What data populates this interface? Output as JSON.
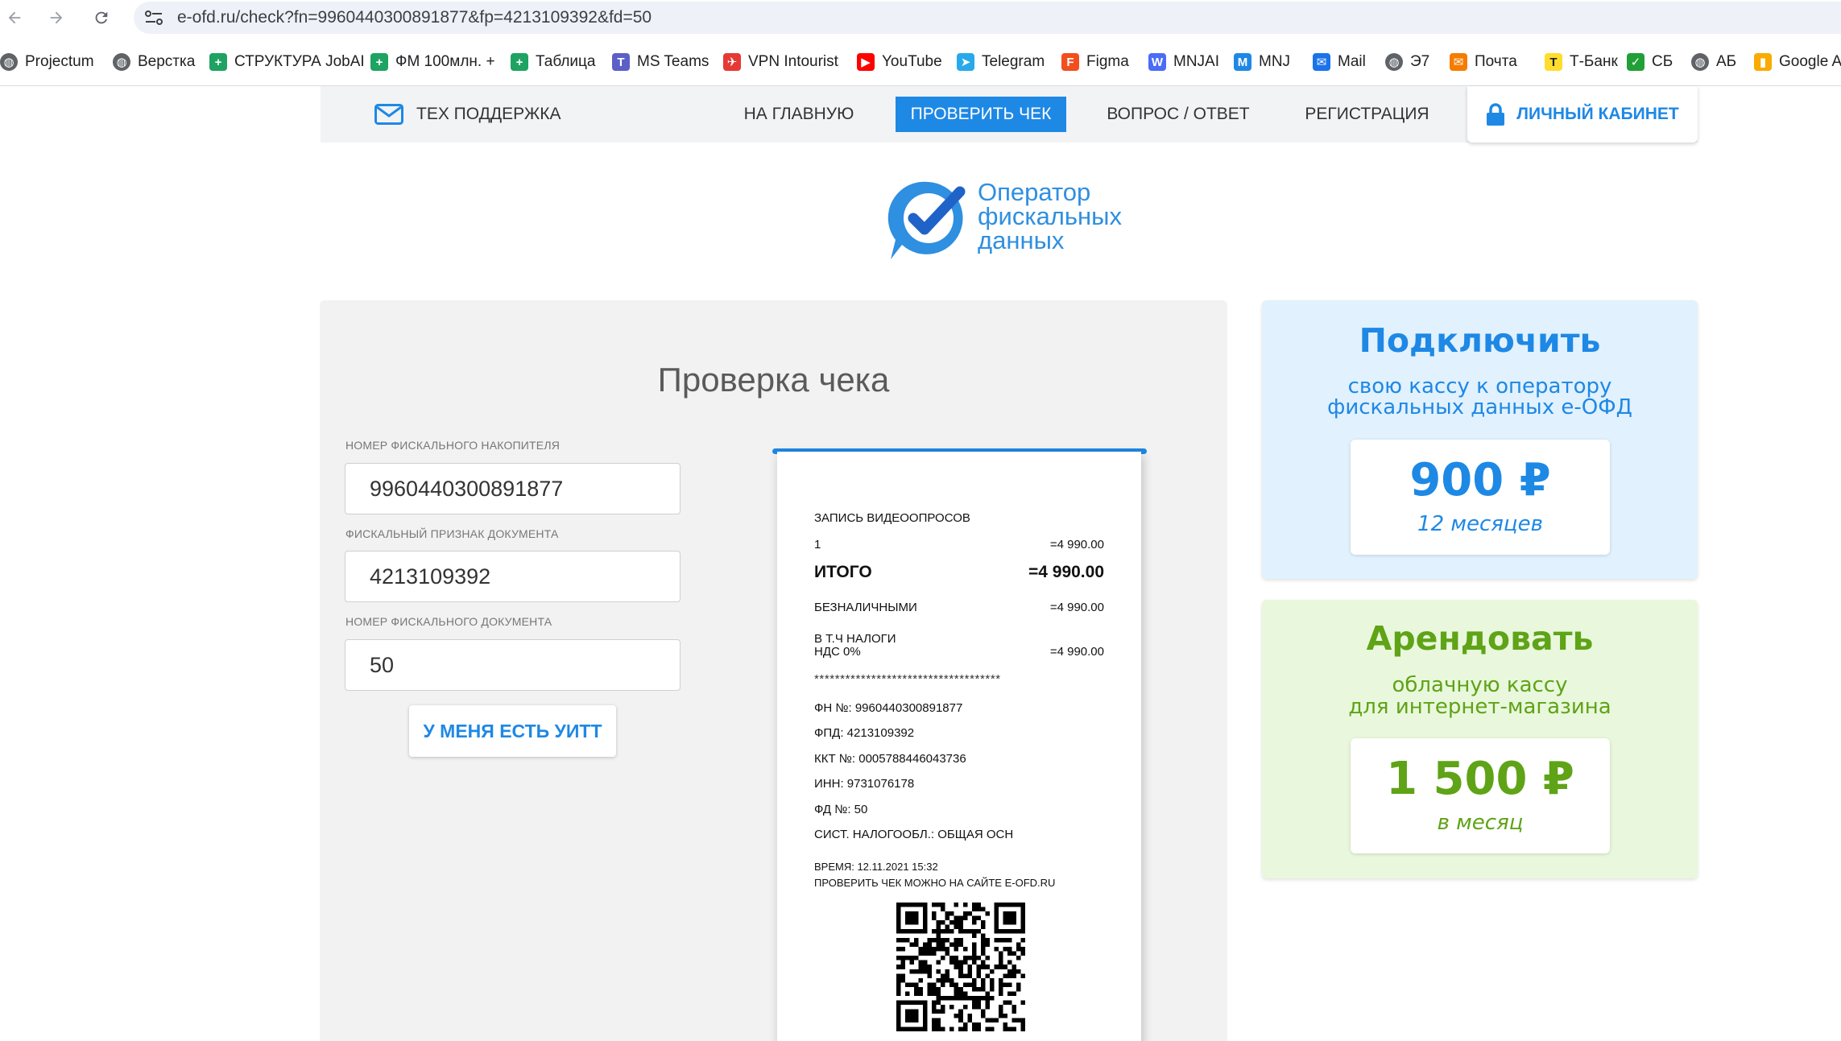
{
  "browser": {
    "url": "e-ofd.ru/check?fn=9960440300891877&fp=4213109392&fd=50",
    "bookmarks": [
      {
        "label": "Projectum",
        "icon": "globe-icon",
        "color": "#5f6368"
      },
      {
        "label": "Верстка",
        "icon": "globe-icon",
        "color": "#5f6368"
      },
      {
        "label": "СТРУКТУРА JobAI",
        "icon": "sheets-icon",
        "color": "#1ea362"
      },
      {
        "label": "ФМ 100млн. +",
        "icon": "sheets-icon",
        "color": "#1ea362"
      },
      {
        "label": "Таблица",
        "icon": "sheets-icon",
        "color": "#1ea362"
      },
      {
        "label": "MS Teams",
        "icon": "teams-icon",
        "color": "#5b5fc7"
      },
      {
        "label": "VPN Intourist",
        "icon": "plane-icon",
        "color": "#e53935"
      },
      {
        "label": "YouTube",
        "icon": "youtube-icon",
        "color": "#ff0000"
      },
      {
        "label": "Telegram",
        "icon": "telegram-icon",
        "color": "#29a9eb"
      },
      {
        "label": "Figma",
        "icon": "figma-icon",
        "color": "#f24e1e"
      },
      {
        "label": "MNJAI",
        "icon": "mnjai-icon",
        "color": "#4a6cf7"
      },
      {
        "label": "MNJ",
        "icon": "mnj-icon",
        "color": "#1e88e5"
      },
      {
        "label": "Mail",
        "icon": "mail-icon",
        "color": "#1a73e8"
      },
      {
        "label": "Э7",
        "icon": "globe-icon",
        "color": "#5f6368"
      },
      {
        "label": "Почта",
        "icon": "envelope-icon",
        "color": "#f57c00"
      },
      {
        "label": "Т-Банк",
        "icon": "tbank-icon",
        "color": "#ffdd2d"
      },
      {
        "label": "СБ",
        "icon": "sber-icon",
        "color": "#21a038"
      },
      {
        "label": "АБ",
        "icon": "globe-icon",
        "color": "#5f6368"
      },
      {
        "label": "Google A",
        "icon": "analytics-icon",
        "color": "#f9ab00"
      }
    ]
  },
  "nav": {
    "support": "ТЕХ ПОДДЕРЖКА",
    "links": [
      "НА ГЛАВНУЮ",
      "ПРОВЕРИТЬ ЧЕК",
      "ВОПРОС / ОТВЕТ",
      "РЕГИСТРАЦИЯ"
    ],
    "active_link": "ПРОВЕРИТЬ ЧЕК",
    "cabinet": "ЛИЧНЫЙ КАБИНЕТ"
  },
  "logo": {
    "line1": "Оператор",
    "line2": "фискальных",
    "line3": "данных"
  },
  "check_form": {
    "title": "Проверка чека",
    "fn_label": "НОМЕР ФИСКАЛЬНОГО НАКОПИТЕЛЯ",
    "fn_value": "9960440300891877",
    "fp_label": "ФИСКАЛЬНЫЙ ПРИЗНАК ДОКУМЕНТА",
    "fp_value": "4213109392",
    "fd_label": "НОМЕР ФИСКАЛЬНОГО ДОКУМЕНТА",
    "fd_value": "50",
    "uitt_button": "У МЕНЯ ЕСТЬ УИТТ"
  },
  "receipt": {
    "item_name": "ЗАПИСЬ ВИДЕООПРОСОВ",
    "item_qty": "1",
    "item_sum": "=4 990.00",
    "total_label": "ИТОГО",
    "total_value": "=4 990.00",
    "cashless_label": "БЕЗНАЛИЧНЫМИ",
    "cashless_value": "=4 990.00",
    "tax_label_1": "В Т.Ч НАЛОГИ",
    "tax_label_2": "НДС 0%",
    "tax_value": "=4 990.00",
    "stars": "************************************",
    "fn": "ФН №: 9960440300891877",
    "fpd": "ФПД: 4213109392",
    "kkt": "ККТ №: 0005788446043736",
    "inn": "ИНН: 9731076178",
    "fd": "ФД №: 50",
    "tax_system": "СИСТ. НАЛОГООБЛ.: ОБЩАЯ ОСН",
    "time": "ВРЕМЯ: 12.11.2021 15:32",
    "check_site": "ПРОВЕРИТЬ ЧЕК МОЖНО НА САЙТЕ E-OFD.RU"
  },
  "promo_connect": {
    "title": "Подключить",
    "subtitle_1": "свою кассу к оператору",
    "subtitle_2": "фискальных данных е-ОФД",
    "price": "900 ₽",
    "term": "12 месяцев",
    "color": "#1e88e5"
  },
  "promo_rent": {
    "title": "Арендовать",
    "subtitle_1": "облачную кассу",
    "subtitle_2": "для интернет-магазина",
    "price": "1 500 ₽",
    "term": "в месяц",
    "color": "#5fa317"
  },
  "colors": {
    "accent": "#1e88e5",
    "nav_bg": "#f2f3f4",
    "panel_bg": "#f2f2f2"
  }
}
